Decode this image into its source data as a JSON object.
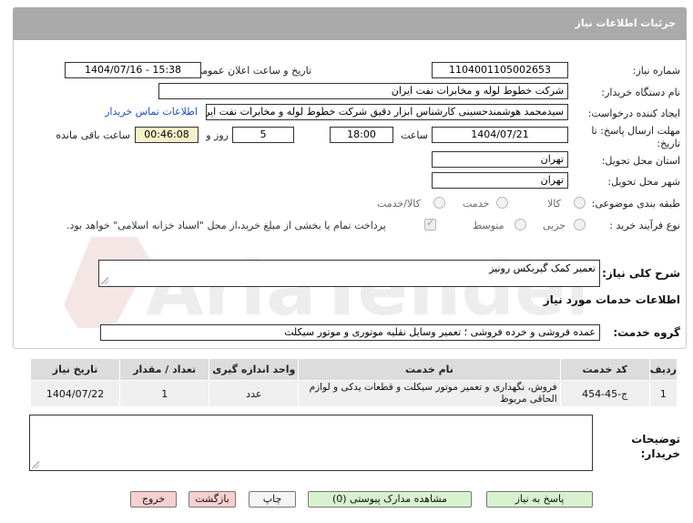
{
  "header": {
    "title": "جزئیات اطلاعات نیاز"
  },
  "fields": {
    "need_number_label": "شماره نیاز:",
    "need_number": "1104001105002653",
    "announce_label": "تاریخ و ساعت اعلان عمومی:",
    "announce_value": "1404/07/16 - 15:38",
    "buyer_org_label": "نام دستگاه خریدار:",
    "buyer_org": "شرکت خطوط لوله و مخابرات نفت ایران",
    "creator_label": "ایجاد کننده درخواست:",
    "creator": "سیدمحمد هوشمندحسینی کارشناس ابزار دقیق شرکت خطوط لوله و مخابرات نفت ایران",
    "contact_link": "اطلاعات تماس خریدار",
    "deadline_label": "مهلت ارسال پاسخ: تا تاریخ:",
    "deadline_date": "1404/07/21",
    "hour_label": "ساعت",
    "deadline_hour": "18:00",
    "days_value": "5",
    "days_label": "روز و",
    "remaining_time": "00:46:08",
    "remaining_label": "ساعت باقی مانده",
    "province_label": "استان محل تحویل:",
    "province": "تهران",
    "city_label": "شهر محل تحویل:",
    "city": "تهران",
    "category_label": "طبقه بندی موضوعی:",
    "category_options": [
      "کالا",
      "خدمت",
      "کالا/خدمت"
    ],
    "purchase_type_label": "نوع فرآیند خرید :",
    "purchase_options": [
      "جزیی",
      "متوسط"
    ],
    "payment_note": "پرداخت تمام یا بخشی از مبلغ خرید،از محل \"اسناد خزانه اسلامی\" خواهد بود."
  },
  "description": {
    "label": "شرح کلی نیاز:",
    "value": "تعمیر کمک گیربکس رونیز"
  },
  "services": {
    "section_title": "اطلاعات خدمات مورد نیاز",
    "group_label": "گروه خدمت:",
    "group_value": "عمده فروشی و خرده فروشی ؛ تعمیر وسایل نقلیه موتوری و موتور سیکلت",
    "columns": [
      "ردیف",
      "کد خدمت",
      "نام خدمت",
      "واحد اندازه گیری",
      "تعداد / مقدار",
      "تاریخ نیاز"
    ],
    "rows": [
      [
        "1",
        "ج-45-454",
        "فروش، نگهداری و تعمیر موتور سیکلت و قطعات یدکی و لوازم الحاقی مربوط",
        "عدد",
        "1",
        "1404/07/22"
      ]
    ]
  },
  "buyer_notes_label": "توضیحات خریدار:",
  "buttons": {
    "reply": "پاسخ به نیاز",
    "view_docs": "مشاهده مدارک پیوستی (0)",
    "print": "چاپ",
    "back": "بازگشت",
    "exit": "خروج"
  }
}
